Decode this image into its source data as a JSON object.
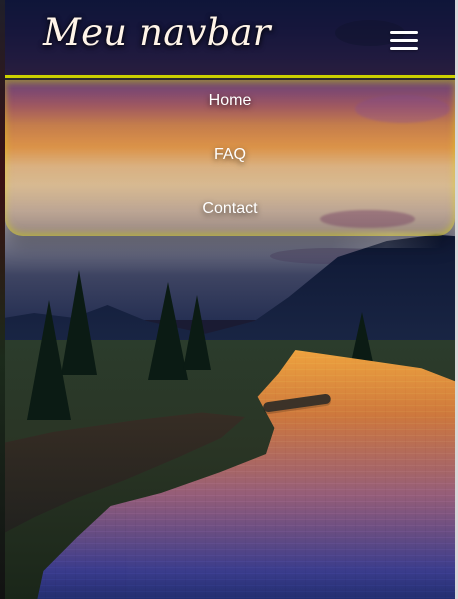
{
  "navbar": {
    "brand": "Meu navbar",
    "menu_icon": "hamburger-menu-icon"
  },
  "menu": {
    "items": [
      {
        "label": "Home"
      },
      {
        "label": "FAQ"
      },
      {
        "label": "Contact"
      }
    ]
  },
  "colors": {
    "nav_glow": "#cfd400",
    "brand_text": "#fff4e8",
    "menu_text": "#ffffff"
  }
}
